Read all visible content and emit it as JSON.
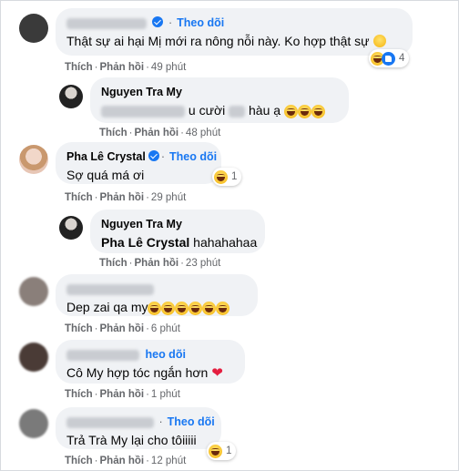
{
  "comments": [
    {
      "follow": "Theo dõi",
      "text": "Thật sự ai hại Mị mới ra nông nỗi này. Ko hợp thật sự",
      "like": "Thích",
      "reply": "Phản hồi",
      "time": "49 phút",
      "reaction_count": "4"
    },
    {
      "name": "Nguyen Tra My",
      "text_visible": "u cười",
      "text_tail": "hàu ạ",
      "like": "Thích",
      "reply": "Phản hồi",
      "time": "48 phút"
    },
    {
      "name": "Pha Lê Crystal",
      "follow": "Theo dõi",
      "text": "Sợ quá má ơi",
      "like": "Thích",
      "reply": "Phản hồi",
      "time": "29 phút",
      "reaction_count": "1"
    },
    {
      "name": "Nguyen Tra My",
      "mention": "Pha Lê Crystal",
      "text": "hahahahaa",
      "like": "Thích",
      "reply": "Phản hồi",
      "time": "23 phút"
    },
    {
      "text": "Dep zai qa my",
      "like": "Thích",
      "reply": "Phản hồi",
      "time": "6 phút"
    },
    {
      "follow": "heo dõi",
      "text": "Cô My hợp tóc ngắn hơn",
      "like": "Thích",
      "reply": "Phản hồi",
      "time": "1 phút"
    },
    {
      "follow": "Theo dõi",
      "text": "Trả Trà My lại cho tôiiiii",
      "like": "Thích",
      "reply": "Phản hồi",
      "time": "12 phút",
      "reaction_count": "1"
    }
  ],
  "colors": {
    "link_blue": "#1877f2",
    "bubble_bg": "#f0f2f5",
    "meta_gray": "#65676b",
    "heart_red": "#e41e3f"
  }
}
